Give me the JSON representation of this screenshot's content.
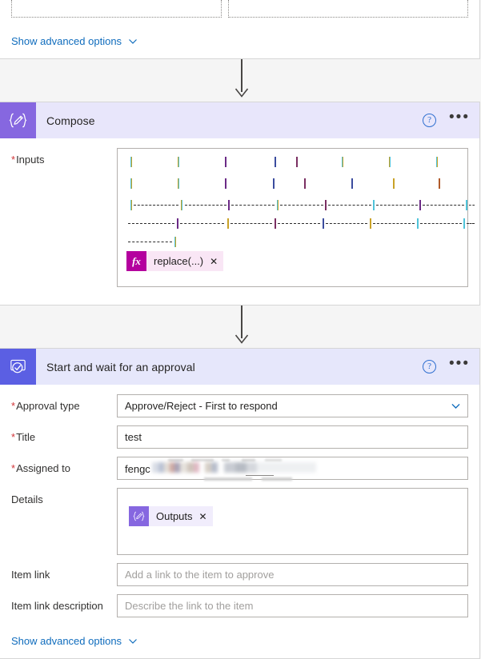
{
  "theme": {
    "page_bg": "#f5f5f5",
    "compose_accent": "#8667e0",
    "approval_accent": "#5b5fe3",
    "header_compose_bg": "#e8e6fb",
    "header_approval_bg": "#e6e7fb",
    "link_blue": "#0f6cbd",
    "required_red": "#d13438",
    "fx_magenta": "#b4009e"
  },
  "top_card": {
    "advanced_link": {
      "label": "Show advanced options",
      "icon": "chevron-down-icon"
    }
  },
  "compose_card": {
    "title": "Compose",
    "icon": "compose-icon",
    "help_icon": "help-circle-icon",
    "menu_icon": "ellipsis-icon",
    "fields": [
      {
        "label": "Inputs",
        "required": true,
        "content_type": "redacted-expression",
        "redacted_note": "blurred multi-line expression text"
      }
    ],
    "token": {
      "icon": "fx-icon",
      "label": "replace(...)",
      "close_icon": "close-icon"
    }
  },
  "approval_card": {
    "title": "Start and wait for an approval",
    "icon": "approval-checkmark-icon",
    "help_icon": "help-circle-icon",
    "menu_icon": "ellipsis-icon",
    "fields": {
      "approval_type": {
        "label": "Approval type",
        "required": true,
        "value": "Approve/Reject - First to respond",
        "icon": "chevron-down-icon"
      },
      "title": {
        "label": "Title",
        "required": true,
        "value": "test"
      },
      "assigned_to": {
        "label": "Assigned to",
        "required": true,
        "value": "fengc",
        "redacted_suffix": true
      },
      "details": {
        "label": "Details",
        "required": false,
        "token": {
          "icon": "compose-icon",
          "label": "Outputs",
          "close_icon": "close-icon"
        }
      },
      "item_link": {
        "label": "Item link",
        "required": false,
        "value": "",
        "placeholder": "Add a link to the item to approve"
      },
      "item_link_description": {
        "label": "Item link description",
        "required": false,
        "value": "",
        "placeholder": "Describe the link to the item"
      }
    },
    "advanced_link": {
      "label": "Show advanced options",
      "icon": "chevron-down-icon"
    }
  },
  "connectors": [
    {
      "icon": "arrow-down-icon"
    },
    {
      "icon": "arrow-down-icon"
    }
  ]
}
